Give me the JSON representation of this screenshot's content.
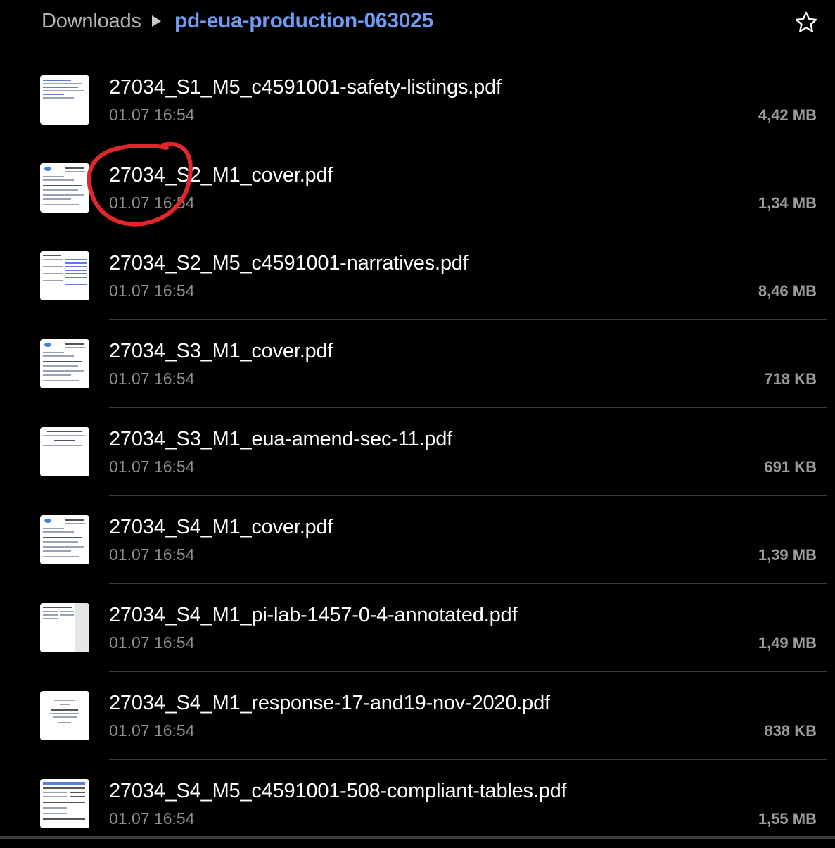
{
  "header": {
    "root_label": "Downloads",
    "current_folder": "pd-eua-production-063025",
    "accent_color": "#6f9bf5",
    "favorite_icon": "star-outline-icon"
  },
  "files": [
    {
      "name": "27034_S1_M5_c4591001-safety-listings.pdf",
      "date": "01.07 16:54",
      "size": "4,42 MB"
    },
    {
      "name": "27034_S2_M1_cover.pdf",
      "date": "01.07 16:54",
      "size": "1,34 MB"
    },
    {
      "name": "27034_S2_M5_c4591001-narratives.pdf",
      "date": "01.07 16:54",
      "size": "8,46 MB"
    },
    {
      "name": "27034_S3_M1_cover.pdf",
      "date": "01.07 16:54",
      "size": "718 KB"
    },
    {
      "name": "27034_S3_M1_eua-amend-sec-11.pdf",
      "date": "01.07 16:54",
      "size": "691 KB"
    },
    {
      "name": "27034_S4_M1_cover.pdf",
      "date": "01.07 16:54",
      "size": "1,39 MB"
    },
    {
      "name": "27034_S4_M1_pi-lab-1457-0-4-annotated.pdf",
      "date": "01.07 16:54",
      "size": "1,49 MB"
    },
    {
      "name": "27034_S4_M1_response-17-and19-nov-2020.pdf",
      "date": "01.07 16:54",
      "size": "838 KB"
    },
    {
      "name": "27034_S4_M5_c4591001-508-compliant-tables.pdf",
      "date": "01.07 16:54",
      "size": "1,55 MB"
    }
  ],
  "annotation": {
    "type": "hand-drawn-circle",
    "color": "#e3262b"
  }
}
